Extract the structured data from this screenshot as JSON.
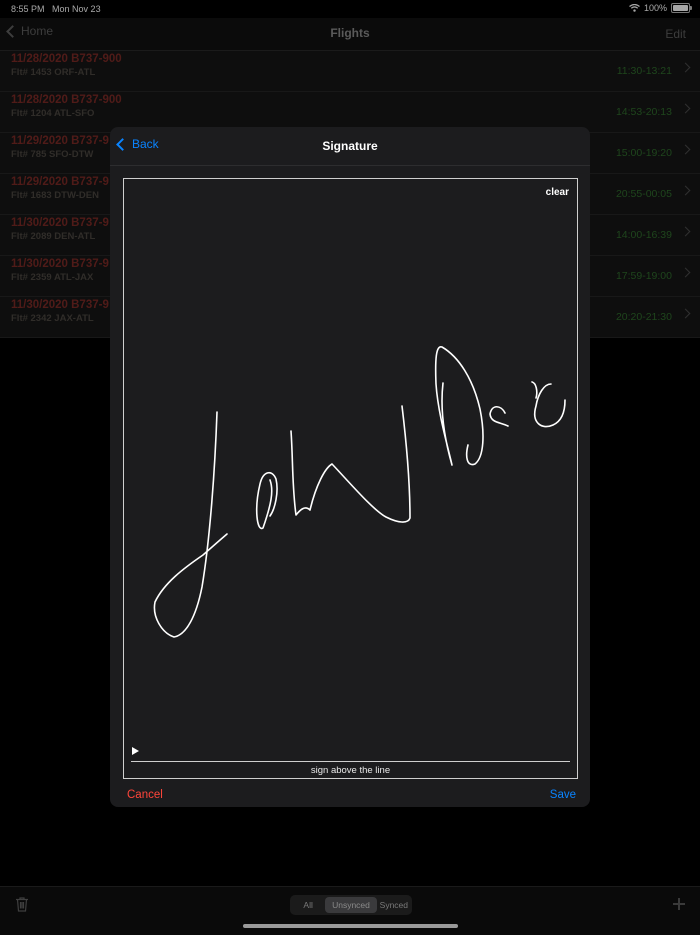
{
  "status_bar": {
    "time": "8:55 PM",
    "date": "Mon Nov 23",
    "battery": "100%",
    "wifi_icon": "wifi-icon"
  },
  "navbar": {
    "back_label": "Home",
    "title": "Flights",
    "edit_label": "Edit"
  },
  "flights": [
    {
      "title": "11/28/2020 B737-900",
      "sub": "Flt# 1453 ORF-ATL",
      "times": "11:30-13:21"
    },
    {
      "title": "11/28/2020 B737-900",
      "sub": "Flt# 1204 ATL-SFO",
      "times": "14:53-20:13"
    },
    {
      "title": "11/29/2020 B737-9",
      "sub": "Flt# 785 SFO-DTW",
      "times": "15:00-19:20"
    },
    {
      "title": "11/29/2020 B737-9",
      "sub": "Flt# 1683 DTW-DEN",
      "times": "20:55-00:05"
    },
    {
      "title": "11/30/2020 B737-9",
      "sub": "Flt# 2089 DEN-ATL",
      "times": "14:00-16:39"
    },
    {
      "title": "11/30/2020 B737-9",
      "sub": "Flt# 2359 ATL-JAX",
      "times": "17:59-19:00"
    },
    {
      "title": "11/30/2020 B737-9",
      "sub": "Flt# 2342 JAX-ATL",
      "times": "20:20-21:30"
    }
  ],
  "modal": {
    "back_label": "Back",
    "title": "Signature",
    "clear_label": "clear",
    "caption": "sign above the line",
    "cancel_label": "Cancel",
    "save_label": "Save"
  },
  "toolbar": {
    "segments": [
      "All",
      "Unsynced",
      "Synced"
    ],
    "selected_segment": "Unsynced"
  },
  "colors": {
    "accent_blue": "#0a84ff",
    "cancel_red": "#ff453a",
    "flight_title_red": "#7b2a26",
    "time_green": "#2f6b2c"
  }
}
